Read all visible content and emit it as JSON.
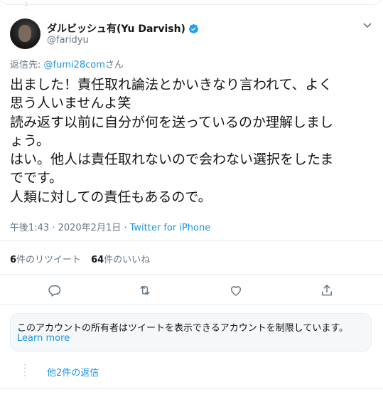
{
  "author": {
    "name": "ダルビッシュ有(Yu Darvish)",
    "handle": "@faridyu"
  },
  "reply_to": {
    "prefix": "返信先: ",
    "mention": "@fumi28com",
    "suffix": "さん"
  },
  "tweet": {
    "lines": [
      "出ました！責任取れ論法とかいきなり言われて、よく",
      "思う人いませんよ笑",
      "読み返す以前に自分が何を送っているのか理解しまし",
      "ょう。",
      "はい。他人は責任取れないので会わない選択をしたま",
      "でです。",
      "人類に対しての責任もあるので。"
    ]
  },
  "meta": {
    "time": "午後1:43 · 2020年2月1日 · ",
    "source": "Twitter for iPhone"
  },
  "stats": {
    "retweets_count": "6",
    "retweets_label": "件のリツイート",
    "likes_count": "64",
    "likes_label": "件のいいね"
  },
  "icons": {
    "reply": "reply-icon",
    "retweet": "retweet-icon",
    "like": "heart-icon",
    "share": "share-icon",
    "verified": "verified-badge-icon",
    "menu": "chevron-down-icon"
  },
  "notice": {
    "text": "このアカウントの所有者はツイートを表示できるアカウントを制限しています。",
    "link": "Learn more"
  },
  "more_replies": "他2件の返信",
  "colors": {
    "link": "#1b95e0",
    "secondary_text": "#657786",
    "border": "#e6ecf0",
    "notice_bg": "#f5f8fa"
  }
}
